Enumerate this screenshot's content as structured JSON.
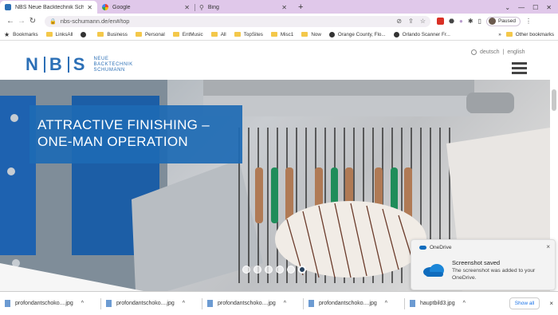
{
  "browser": {
    "tabs": [
      {
        "title": "NBS Neue Backtechnik Schuman",
        "active": true
      },
      {
        "title": "Google",
        "active": false
      },
      {
        "title": "Bing",
        "active": false
      }
    ],
    "new_tab": "+",
    "url": "nbs-schumann.de/en#/top",
    "profile_status": "Paused",
    "bookmarks": [
      "Bookmarks",
      "LinksAll",
      "Business",
      "Personal",
      "EntMusic",
      "All",
      "TopSites",
      "Misc1",
      "Now",
      "Orange County, Flo...",
      "Orlando Scanner Fr..."
    ],
    "other_bookmarks": "Other bookmarks",
    "more": "»"
  },
  "site": {
    "logo_letters": [
      "N",
      "B",
      "S"
    ],
    "logo_sub": [
      "NEUE",
      "BACKTECHNIK",
      "SCHUMANN"
    ],
    "lang_de": "deutsch",
    "lang_sep": "|",
    "lang_en": "english",
    "hero_title": "ATTRACTIVE FINISHING –\nONE-MAN OPERATION",
    "slide_count": 6,
    "active_slide": 6
  },
  "toast": {
    "app": "OneDrive",
    "title": "Screenshot saved",
    "body": "The screenshot was added to your OneDrive.",
    "close": "×"
  },
  "downloads": {
    "items": [
      "profondantschoko....jpg",
      "profondantschoko....jpg",
      "profondantschoko....jpg",
      "profondantschoko....jpg",
      "hauptbild3.jpg"
    ],
    "show_all": "Show all",
    "close": "×"
  },
  "colors": {
    "brand_blue": "#2b6fb6",
    "hero_box": "#1d6ab4",
    "tabbar": "#e0c8ea"
  }
}
